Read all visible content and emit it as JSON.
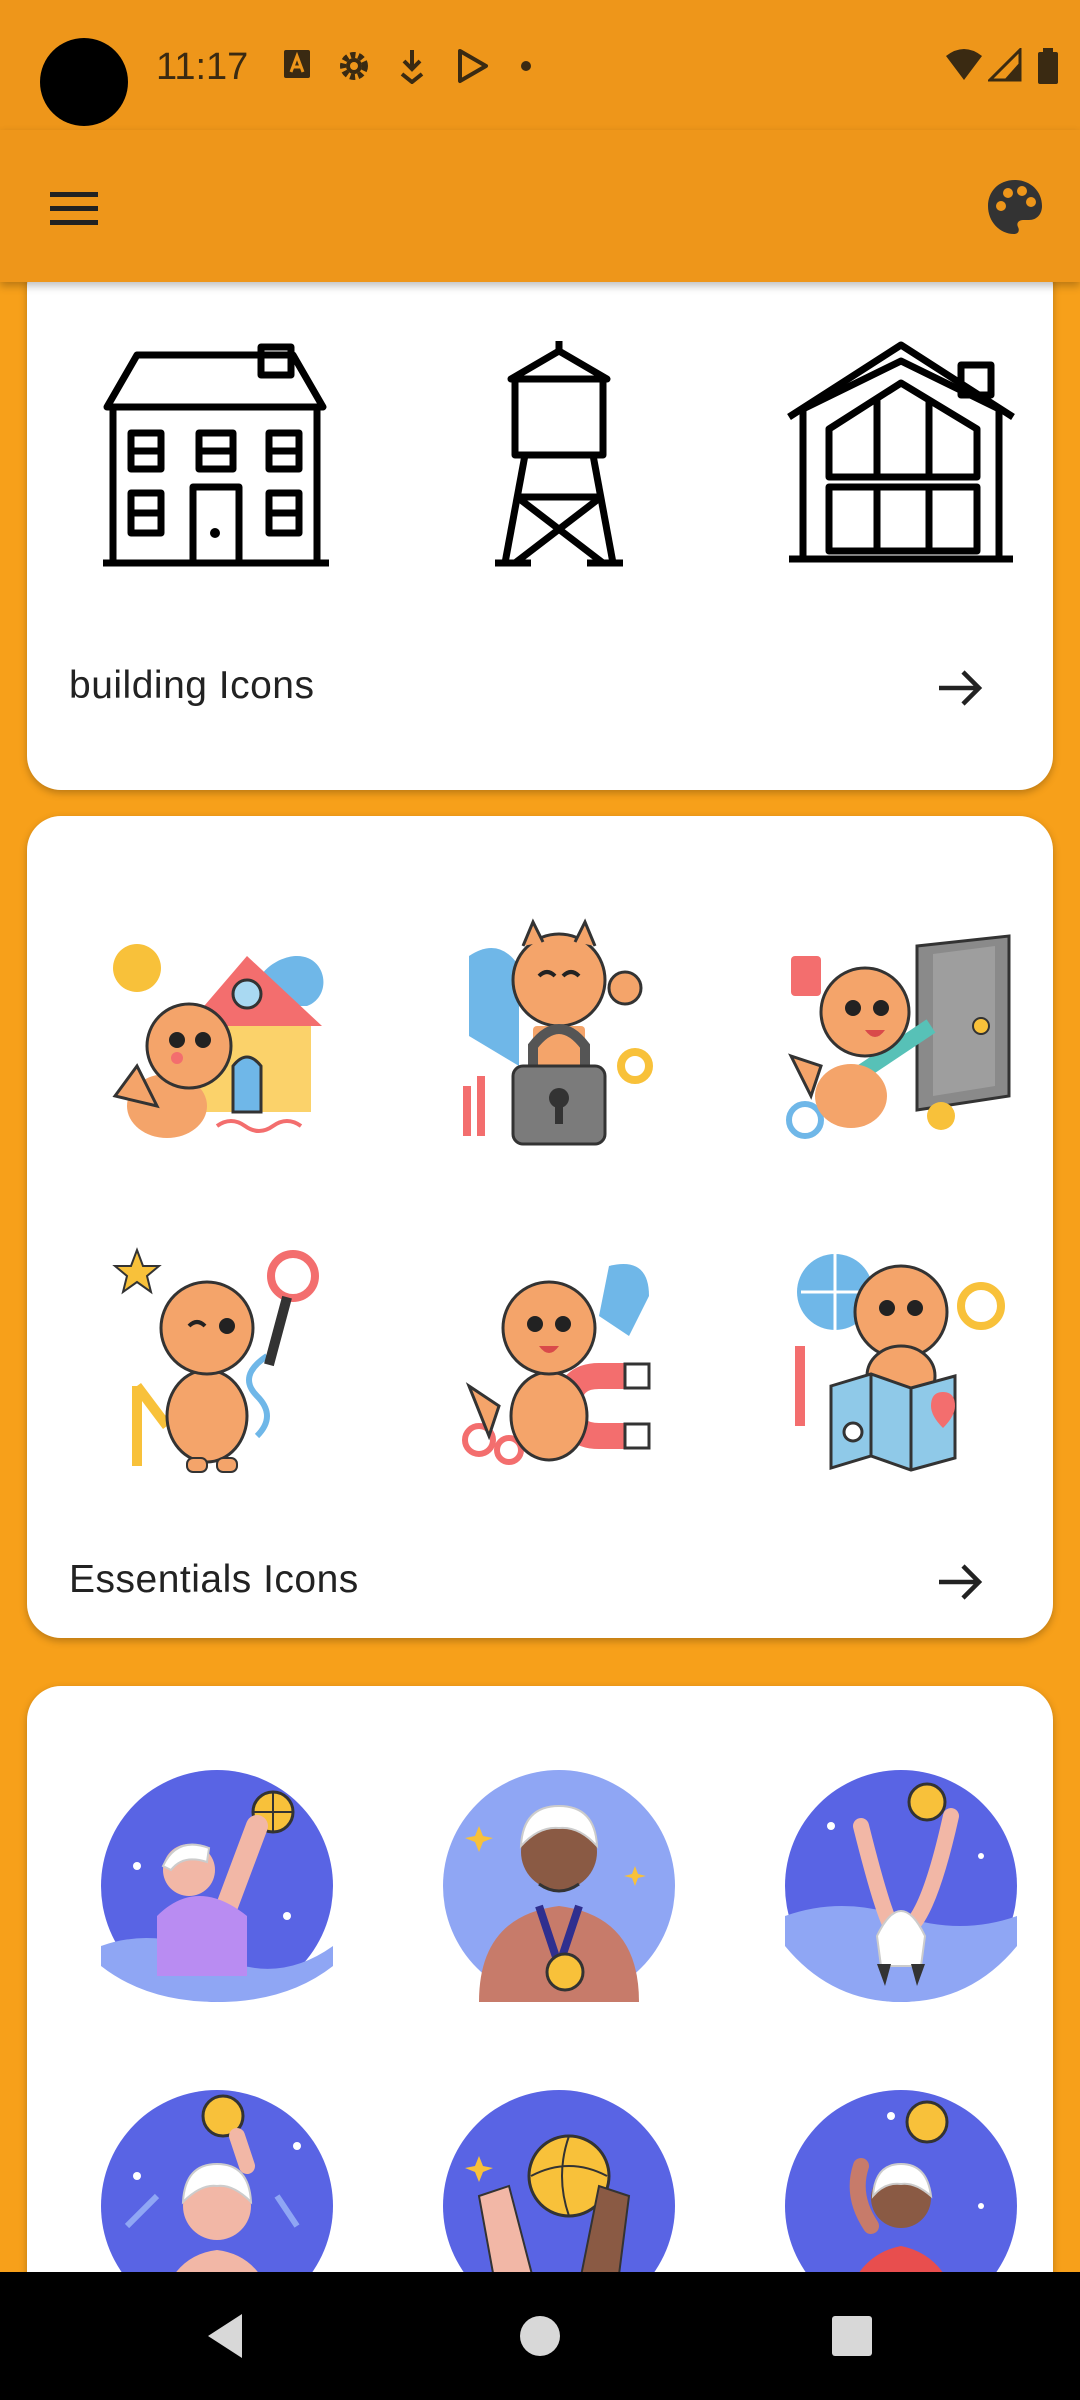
{
  "status_bar": {
    "time": "11:17",
    "icons": [
      "a-box-icon",
      "settings-icon",
      "download-icon",
      "play-store-icon",
      "dot-icon",
      "wifi-icon",
      "signal-icon",
      "battery-icon"
    ]
  },
  "app_bar": {
    "menu_icon": "hamburger-menu-icon",
    "action_icon": "palette-icon"
  },
  "colors": {
    "accent": "#EE961A",
    "background": "#F7A01A",
    "card": "#FFFFFF",
    "text": "#222222"
  },
  "cards": [
    {
      "title": "building Icons",
      "icons": [
        "house-icon",
        "water-tower-icon",
        "barn-icon"
      ]
    },
    {
      "title": "Essentials Icons",
      "icons": [
        "fox-house-sticker",
        "fox-lock-sticker",
        "fox-door-sticker",
        "fox-magic-wand-sticker",
        "fox-magnet-sticker",
        "fox-map-sticker"
      ]
    },
    {
      "title": "",
      "icons": [
        "water-polo-player-icon",
        "medal-winner-icon",
        "ball-catch-icon",
        "ball-raise-icon",
        "high-five-icon",
        "swimmer-ball-icon"
      ]
    }
  ],
  "nav_bar": {
    "icons": [
      "back-icon",
      "home-icon",
      "recents-icon"
    ]
  }
}
